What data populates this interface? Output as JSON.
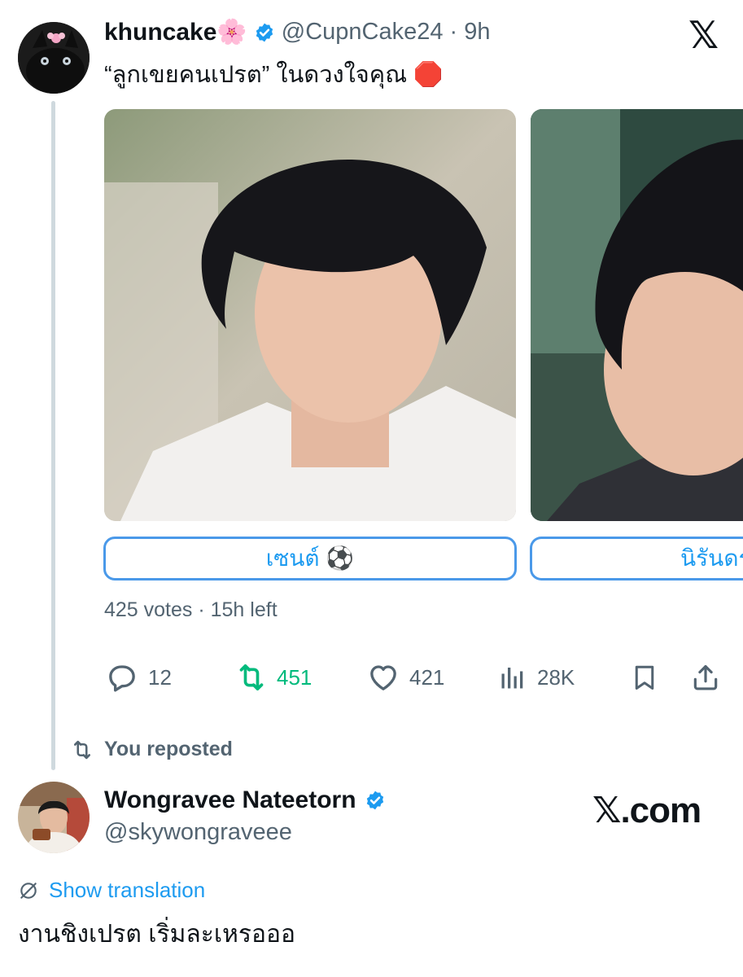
{
  "top_tweet": {
    "display_name": "khuncake🌸",
    "handle": "@CupnCake24",
    "time": "· 9h",
    "text": "“ลูกเขยคนเปรต” ในดวงใจคุณ 🛑",
    "poll_options": [
      "เซนต์ ⚽️",
      "นิรันดร"
    ],
    "poll_meta": "425 votes · 15h left",
    "stats": {
      "replies": "12",
      "reposts": "451",
      "likes": "421",
      "views": "28K"
    }
  },
  "repost_notice": "You reposted",
  "bottom_tweet": {
    "display_name": "Wongravee Nateetorn",
    "handle": "@skywongraveee",
    "translate_label": "Show translation",
    "text": "งานชิงเปรต เริ่มละเหรอออ"
  },
  "brand": {
    "top_logo": "𝕏",
    "watermark": "𝕏.com"
  },
  "colors": {
    "accent": "#1d9bf0",
    "repost_green": "#00ba7c",
    "muted": "#536471"
  },
  "icons": {
    "reply": "speech-bubble",
    "repost": "repost-arrows",
    "like": "heart",
    "views": "bar-chart",
    "bookmark": "bookmark",
    "share": "share-up-arrow",
    "translate": "globe-slash",
    "verified": "verified-badge"
  }
}
